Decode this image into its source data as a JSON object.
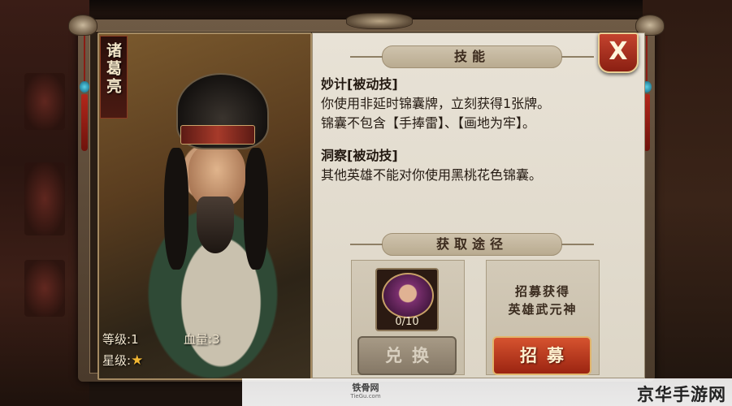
{
  "hero": {
    "name": "诸葛亮",
    "level_label": "等级",
    "level_sep": ":",
    "level_value": "1",
    "hp_label": "血量",
    "hp_sep": ":",
    "hp_value": "3",
    "star_label": "星级",
    "star_sep": ":",
    "stars": 1,
    "star_glyph": "★"
  },
  "skills_panel": {
    "banner": "技能",
    "skills": [
      {
        "title": "妙计[被动技]",
        "lines": [
          "你使用非延时锦囊牌，立刻获得1张牌。",
          "锦囊不包含【手捧雷】、【画地为牢】。"
        ]
      },
      {
        "title": "洞察[被动技]",
        "lines": [
          "其他英雄不能对你使用黑桃花色锦囊。"
        ]
      }
    ]
  },
  "obtain": {
    "banner": "获取途径",
    "fragment_count": "0/10",
    "recruit_text_lines": [
      "招募获得",
      "英雄武元神"
    ],
    "exchange_button": "兑换",
    "recruit_button": "招募"
  },
  "close_button": "X",
  "watermark": {
    "logo_text": "铁骨网",
    "logo_sub": "TieGu.com",
    "site_text": "京华手游网"
  },
  "colors": {
    "accent_red": "#b8361f",
    "star": "#f2b733",
    "panel_bg": "#e6e0d3"
  }
}
